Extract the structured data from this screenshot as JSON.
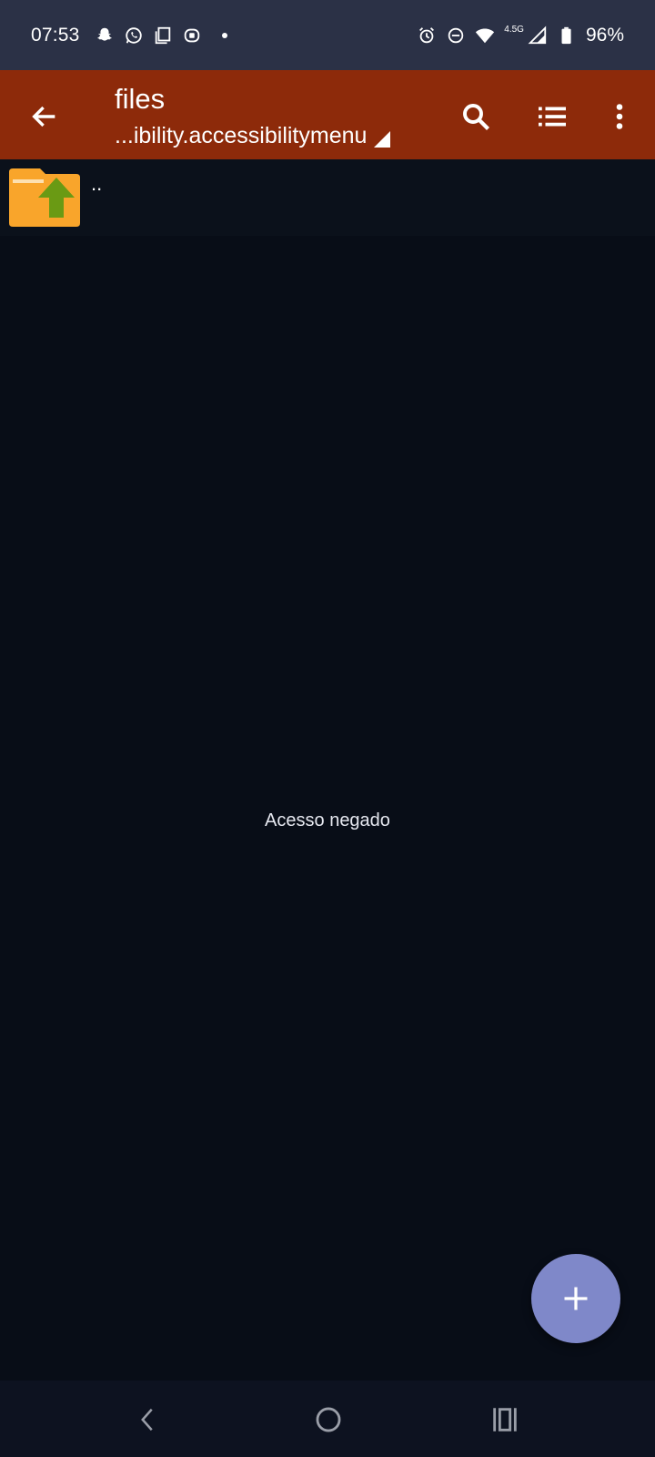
{
  "status_bar": {
    "time": "07:53",
    "left_icons": [
      "snapchat-icon",
      "whatsapp-icon",
      "copy-icon",
      "teams-icon",
      "dot-icon"
    ],
    "right_icons": [
      "alarm-icon",
      "dnd-icon",
      "wifi-icon",
      "signal-icon",
      "battery-icon"
    ],
    "network_type": "4.5G",
    "battery_text": "96%"
  },
  "app_bar": {
    "title": "files",
    "path": "...ibility.accessibilitymenu",
    "actions": [
      "search-icon",
      "list-view-icon",
      "more-options-icon"
    ]
  },
  "file_list": {
    "items": [
      {
        "name": "..",
        "icon": "folder-up-icon"
      }
    ]
  },
  "empty_message": "Acesso negado",
  "fab": {
    "icon": "plus-icon"
  },
  "navigation_bar": {
    "buttons": [
      "back-icon",
      "home-icon",
      "recents-icon"
    ]
  },
  "colors": {
    "status_bar": "#2b3146",
    "app_bar": "#8d2a0a",
    "background": "#080d17",
    "fab": "#7f88c9",
    "folder": "#f9a52b",
    "folder_arrow": "#6a9a14"
  }
}
